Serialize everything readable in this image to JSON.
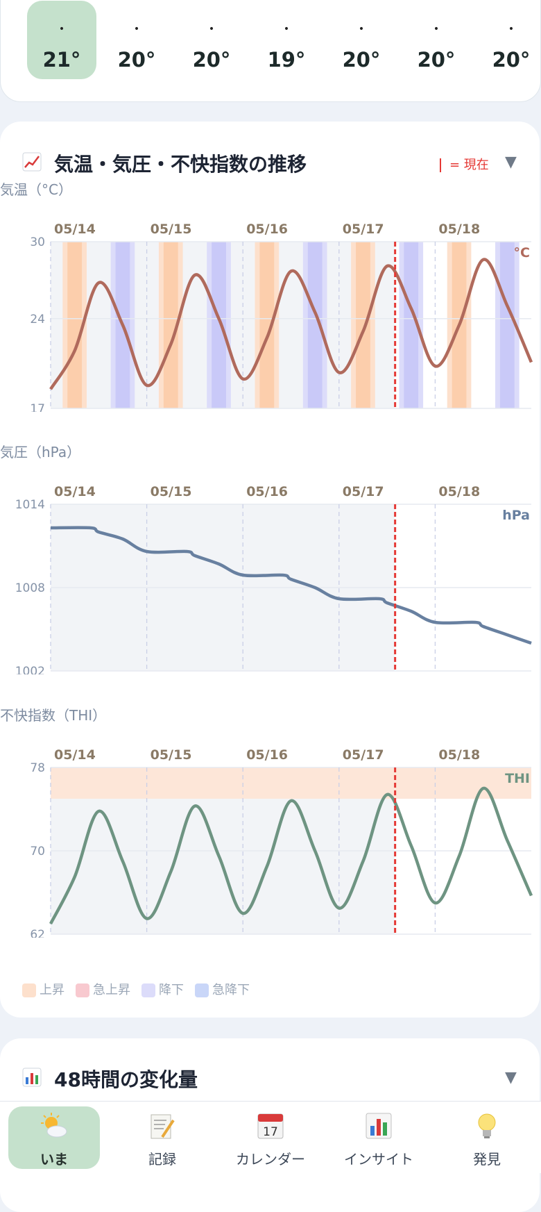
{
  "hourly": {
    "items": [
      {
        "dot": "•",
        "temp": "21°",
        "selected": true
      },
      {
        "dot": "•",
        "temp": "20°"
      },
      {
        "dot": "•",
        "temp": "20°"
      },
      {
        "dot": "•",
        "temp": "19°"
      },
      {
        "dot": "•",
        "temp": "20°"
      },
      {
        "dot": "•",
        "temp": "20°"
      },
      {
        "dot": "•",
        "temp": "20°"
      }
    ]
  },
  "trend": {
    "icon": "chart-up-icon",
    "title": "気温・気圧・不快指数の推移",
    "now_legend": "= 現在",
    "temp_label": "気温（°C）",
    "pressure_label": "気圧（hPa）",
    "thi_label": "不快指数（THI）",
    "legend": [
      {
        "label": "上昇",
        "color": "#fde0cc"
      },
      {
        "label": "急上昇",
        "color": "#f8c9cf"
      },
      {
        "label": "降下",
        "color": "#dcdcfa"
      },
      {
        "label": "急降下",
        "color": "#c9d6f8"
      }
    ]
  },
  "change": {
    "icon": "bar-chart-icon",
    "title": "48時間の変化量"
  },
  "tabs": [
    {
      "label": "いま",
      "icon": "weather-icon",
      "active": true
    },
    {
      "label": "記録",
      "icon": "notepad-icon"
    },
    {
      "label": "カレンダー",
      "icon": "calendar-icon"
    },
    {
      "label": "インサイト",
      "icon": "chart-icon"
    },
    {
      "label": "発見",
      "icon": "lightbulb-icon"
    }
  ],
  "chart_data": [
    {
      "type": "line",
      "unit_label": "°C",
      "dates": [
        "05/14",
        "05/15",
        "05/16",
        "05/17",
        "05/18"
      ],
      "hour_ticks": [
        "6",
        "12",
        "18"
      ],
      "yticks": [
        "30",
        "24",
        "17"
      ],
      "ylim": [
        17,
        30
      ],
      "now_hour": 86,
      "x_hours": [
        0,
        6,
        12,
        18,
        24,
        30,
        36,
        42,
        48,
        54,
        60,
        66,
        72,
        78,
        84,
        90,
        96,
        102,
        108,
        114,
        120
      ],
      "values": [
        18.5,
        21.5,
        26.8,
        23.5,
        18.8,
        22,
        27.4,
        24,
        19.3,
        22.5,
        27.7,
        24.5,
        19.8,
        23,
        28.1,
        24.8,
        20.3,
        23.5,
        28.6,
        25,
        20.6
      ],
      "color": "#b06a5c",
      "rising_bands": [
        [
          3,
          9
        ],
        [
          27,
          33
        ],
        [
          51,
          57
        ],
        [
          75,
          81
        ],
        [
          99,
          105
        ]
      ],
      "falling_bands": [
        [
          15,
          21
        ],
        [
          39,
          45
        ],
        [
          63,
          69
        ],
        [
          87,
          93
        ],
        [
          111,
          117
        ]
      ]
    },
    {
      "type": "line",
      "unit_label": "hPa",
      "dates": [
        "05/14",
        "05/15",
        "05/16",
        "05/17",
        "05/18"
      ],
      "hour_ticks": [
        "6",
        "12",
        "18"
      ],
      "yticks": [
        "1014",
        "1008",
        "1002"
      ],
      "ylim": [
        1002,
        1014
      ],
      "now_hour": 86,
      "x_hours": [
        0,
        10,
        12,
        18,
        24,
        34,
        36,
        42,
        48,
        58,
        60,
        66,
        72,
        82,
        84,
        90,
        96,
        106,
        108,
        114,
        120
      ],
      "values": [
        1012.3,
        1012.3,
        1012.0,
        1011.5,
        1010.6,
        1010.6,
        1010.3,
        1009.7,
        1008.9,
        1008.9,
        1008.6,
        1008.0,
        1007.2,
        1007.2,
        1006.9,
        1006.3,
        1005.5,
        1005.5,
        1005.2,
        1004.6,
        1004.0
      ],
      "color": "#6880a0"
    },
    {
      "type": "line",
      "unit_label": "THI",
      "dates": [
        "05/14",
        "05/15",
        "05/16",
        "05/17",
        "05/18"
      ],
      "hour_ticks": [
        "6",
        "12",
        "18"
      ],
      "yticks": [
        "78",
        "70",
        "62"
      ],
      "ylim": [
        62,
        78
      ],
      "now_hour": 86,
      "x_hours": [
        0,
        6,
        12,
        18,
        24,
        30,
        36,
        42,
        48,
        54,
        60,
        66,
        72,
        78,
        84,
        90,
        96,
        102,
        108,
        114,
        120
      ],
      "values": [
        63,
        67.5,
        73.8,
        69,
        63.5,
        68,
        74.3,
        69.5,
        64,
        68.5,
        74.8,
        70,
        64.5,
        69,
        75.4,
        70.5,
        65,
        69.5,
        76.0,
        71,
        65.7
      ],
      "color": "#6e9482",
      "band": [
        75,
        78
      ]
    }
  ]
}
